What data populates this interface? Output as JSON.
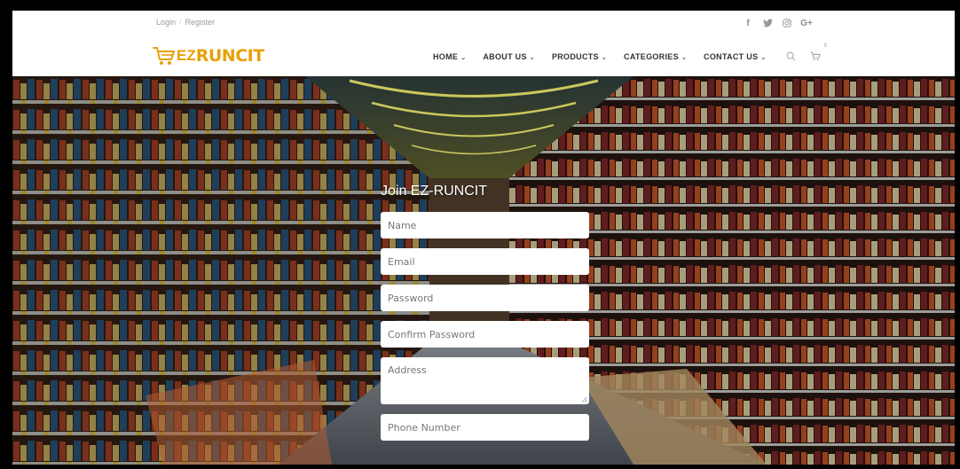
{
  "topbar": {
    "login": "Login",
    "register": "Register",
    "social": [
      "f",
      "t",
      "ig",
      "G+"
    ]
  },
  "logo": {
    "prefix": "EZ",
    "name": "RUNCIT",
    "icon": "cart-icon"
  },
  "nav": {
    "items": [
      {
        "label": "HOME"
      },
      {
        "label": "ABOUT US"
      },
      {
        "label": "PRODUCTS"
      },
      {
        "label": "CATEGORIES"
      },
      {
        "label": "CONTACT US"
      }
    ],
    "cart_count": "0"
  },
  "form": {
    "title": "Join EZ-RUNCIT",
    "fields": [
      {
        "placeholder": "Name"
      },
      {
        "placeholder": "Email"
      },
      {
        "placeholder": "Password"
      },
      {
        "placeholder": "Confirm Password"
      },
      {
        "placeholder": "Address"
      },
      {
        "placeholder": "Phone Number"
      }
    ]
  },
  "colors": {
    "accent": "#e8a008",
    "nav_text": "#333333",
    "muted": "#999999"
  }
}
